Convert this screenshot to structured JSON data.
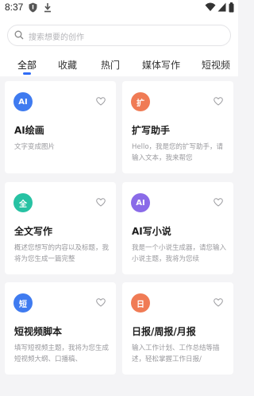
{
  "status_bar": {
    "time": "8:37"
  },
  "search": {
    "placeholder": "搜索想要的创作"
  },
  "tabs": [
    {
      "label": "全部",
      "active": true
    },
    {
      "label": "收藏"
    },
    {
      "label": "热门"
    },
    {
      "label": "媒体写作"
    },
    {
      "label": "短视频"
    }
  ],
  "cards": [
    {
      "icon_text": "AI",
      "icon_color": "#3f7bf0",
      "title": "AI绘画",
      "desc": "文字变成图片"
    },
    {
      "icon_text": "扩",
      "icon_color": "#f07b55",
      "title": "扩写助手",
      "desc": "Hello，我是您的扩写助手，请输入文本，我来帮您"
    },
    {
      "icon_text": "全",
      "icon_color": "#27c2a3",
      "title": "全文写作",
      "desc": "概述您想写的内容以及标题，我将为您生成一篇完整"
    },
    {
      "icon_text": "AI",
      "icon_color": "#8a6be8",
      "title": "AI写小说",
      "desc": "我是一个小说生成器，请您输入小说主题，我将为您续"
    },
    {
      "icon_text": "短",
      "icon_color": "#3f7bf0",
      "title": "短视频脚本",
      "desc": "填写短视频主题，我将为您生成短视频大纲、口播稿、"
    },
    {
      "icon_text": "日",
      "icon_color": "#f07b55",
      "title": "日报/周报/月报",
      "desc": "输入工作计划、工作总结等描述，轻松掌握工作日报/"
    }
  ],
  "colors": {
    "accent": "#2f6cf6",
    "background": "#f4f4f6"
  }
}
